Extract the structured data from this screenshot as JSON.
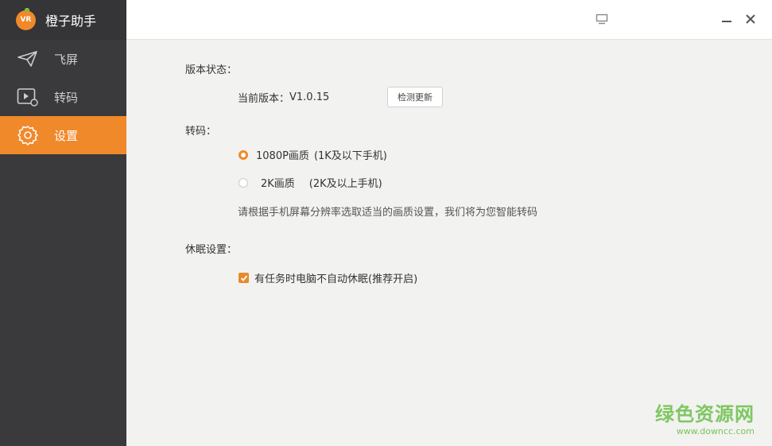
{
  "app": {
    "title": "橙子助手",
    "logo_text": "VR"
  },
  "sidebar": {
    "items": [
      {
        "label": "飞屏",
        "icon": "paper-plane-icon"
      },
      {
        "label": "转码",
        "icon": "video-convert-icon"
      },
      {
        "label": "设置",
        "icon": "gear-icon",
        "active": true
      }
    ]
  },
  "titlebar": {
    "buttons": [
      "monitor-icon",
      "minimize-icon",
      "close-icon"
    ]
  },
  "settings": {
    "version": {
      "section_label": "版本状态：",
      "current_label": "当前版本：",
      "current_value": "V1.0.15",
      "check_button": "检测更新"
    },
    "transcode": {
      "section_label": "转码：",
      "options": [
        {
          "label": "1080P画质",
          "desc": "(1K及以下手机)",
          "selected": true
        },
        {
          "label": "2K画质",
          "desc": "(2K及以上手机)",
          "selected": false
        }
      ],
      "hint": "请根据手机屏幕分辨率选取适当的画质设置，我们将为您智能转码"
    },
    "sleep": {
      "section_label": "休眠设置：",
      "checkbox_label": "有任务时电脑不自动休眠(推荐开启)",
      "checked": true
    }
  },
  "watermark": {
    "title": "绿色资源网",
    "url": "www.downcc.com"
  },
  "colors": {
    "accent": "#f0892a",
    "sidebar_bg": "#3a393b",
    "content_bg": "#f2f2f0"
  }
}
